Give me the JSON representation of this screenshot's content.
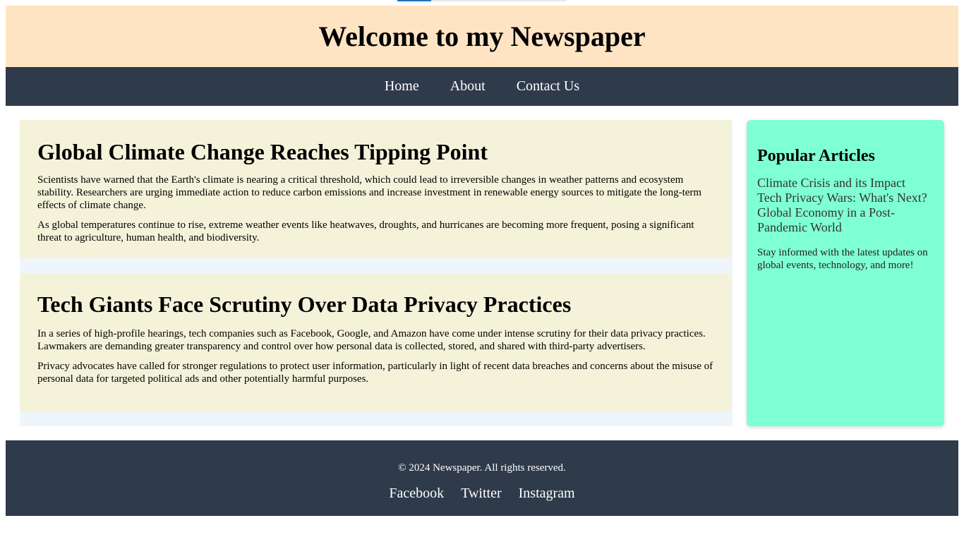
{
  "header": {
    "title": "Welcome to my Newspaper"
  },
  "nav": {
    "items": [
      {
        "label": "Home"
      },
      {
        "label": "About"
      },
      {
        "label": "Contact Us"
      }
    ]
  },
  "articles": [
    {
      "title": "Global Climate Change Reaches Tipping Point",
      "paragraphs": [
        "Scientists have warned that the Earth's climate is nearing a critical threshold, which could lead to irreversible changes in weather patterns and ecosystem stability. Researchers are urging immediate action to reduce carbon emissions and increase investment in renewable energy sources to mitigate the long-term effects of climate change.",
        "As global temperatures continue to rise, extreme weather events like heatwaves, droughts, and hurricanes are becoming more frequent, posing a significant threat to agriculture, human health, and biodiversity."
      ]
    },
    {
      "title": "Tech Giants Face Scrutiny Over Data Privacy Practices",
      "paragraphs": [
        "In a series of high-profile hearings, tech companies such as Facebook, Google, and Amazon have come under intense scrutiny for their data privacy practices. Lawmakers are demanding greater transparency and control over how personal data is collected, stored, and shared with third-party advertisers.",
        "Privacy advocates have called for stronger regulations to protect user information, particularly in light of recent data breaches and concerns about the misuse of personal data for targeted political ads and other potentially harmful purposes."
      ]
    }
  ],
  "sidebar": {
    "title": "Popular Articles",
    "items": [
      {
        "label": "Climate Crisis and its Impact"
      },
      {
        "label": "Tech Privacy Wars: What's Next?"
      },
      {
        "label": "Global Economy in a Post-Pandemic World"
      }
    ],
    "note": "Stay informed with the latest updates on global events, technology, and more!"
  },
  "footer": {
    "copyright": "© 2024 Newspaper. All rights reserved.",
    "social": [
      {
        "label": "Facebook"
      },
      {
        "label": "Twitter"
      },
      {
        "label": "Instagram"
      }
    ]
  },
  "colors": {
    "header_bg": "#ffe4c4",
    "nav_bg": "#2f3a4b",
    "article_bg": "#f4f3da",
    "content_bg": "#eef6fc",
    "sidebar_bg": "#7fffd4",
    "footer_bg": "#2f3a4b",
    "tab_accent": "#1e73be"
  }
}
